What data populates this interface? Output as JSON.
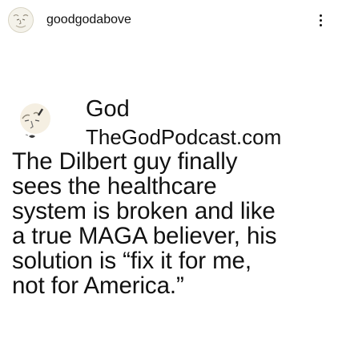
{
  "post": {
    "username": "goodgodabove",
    "avatar_icon": "god-face-icon",
    "more_icon": "vertical-dots-icon"
  },
  "tweet": {
    "avatar_icon": "god-face-icon",
    "name": "God",
    "handle": "TheGodPodcast.com",
    "text": "The Dilbert guy finally\nsees the healthcare\nsystem is broken and like\na true MAGA believer, his\nsolution is “fix it for me,\nnot for America.”"
  },
  "colors": {
    "background": "#ffffff",
    "text": "#111111",
    "avatar_bg": "#f3f1e8"
  }
}
